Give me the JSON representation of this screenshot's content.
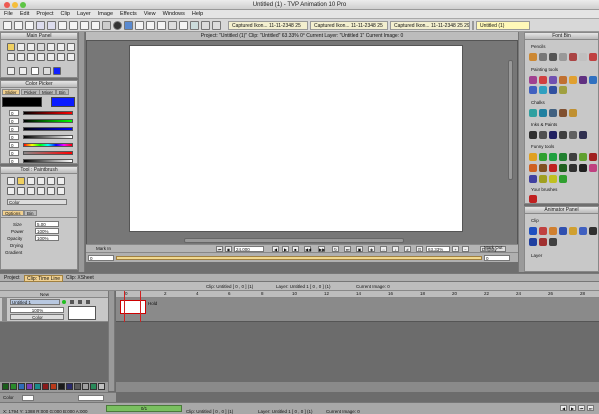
{
  "window": {
    "title": "Untitled (1) - TVP Animation 10 Pro"
  },
  "menu": [
    "File",
    "Edit",
    "Project",
    "Clip",
    "Layer",
    "Image",
    "Effects",
    "View",
    "Windows",
    "Help"
  ],
  "doc_tabs": [
    "Captured Ikon... 11-11-2348 25",
    "Captured Ikon... 11-11-2348 25",
    "Captured Ikon... 11-11-2348 25 2948",
    "Captured Ikon... 11-11-2348 25 2948",
    "Untitled (1)"
  ],
  "project_info": "Project: \"Untitled (1)\"   Clip: \"Untitled\"   63.33%   0°   Current Layer: \"Untitled 1\"   Current Image: 0",
  "main_panel": {
    "title": "Main Panel"
  },
  "color_picker": {
    "title": "Color Picker",
    "tabs": [
      "Slider",
      "Picker",
      "Mixer",
      "Bin"
    ],
    "channels": [
      "0",
      "0",
      "0",
      "0",
      "0",
      "0",
      "0"
    ]
  },
  "tool_panel": {
    "title": "Tool : Paintbrush",
    "tabs": [
      "Options",
      "Bin"
    ],
    "size_label": "Size",
    "size_value": "5.00",
    "power_label": "Power",
    "power_value": "100%",
    "opacity_label": "Opacity",
    "opacity_value": "100%",
    "drying_label": "Drying",
    "gradient_label": "Gradient",
    "mode": "Color"
  },
  "canvas_controls": {
    "mark_in": "Mark In",
    "mark_out": "Mark Out",
    "zoom": "63.33%",
    "display": "Display",
    "fps": "24.000",
    "frame_left": "0",
    "frame_right": "0"
  },
  "font_bin": {
    "title": "Font Bin",
    "sections": [
      "Pencils",
      "Painting tools",
      "Chalks",
      "Inks & Paints",
      "Funny tools",
      "Your brushes"
    ]
  },
  "animator_panel": {
    "title": "Animator Panel",
    "sections": [
      "Clip",
      "Layer"
    ]
  },
  "bottom_tabs": [
    "Project",
    "Clip: Time Line",
    "Clip: XSheet"
  ],
  "timeline_info": {
    "clip": "Clip: Untitled [ 0 , 0 ]  (1)",
    "layer": "Layer: Untitled 1 [ 0 , 0 ]  (1)",
    "image": "Current Image: 0"
  },
  "timeline": {
    "new_label": "New",
    "layer_name": "Untitled 1",
    "opacity": "100%",
    "mode": "Color",
    "hold_label": "Hold",
    "ruler": [
      "0",
      "2",
      "4",
      "6",
      "8",
      "10",
      "12",
      "14",
      "16",
      "18",
      "20",
      "22",
      "24",
      "26",
      "28"
    ]
  },
  "bottom_color": "Color",
  "status": {
    "coords": "X: 1794  Y: 1388  R:000 G:000 B:000 A:000",
    "progress": "0/1",
    "clip": "Clip: Untitled [ 0 , 0 ]  (1)",
    "layer": "Layer: Untitled 1 [ 0 , 0 ]  (1)",
    "image": "Current Image: 0"
  },
  "colors": {
    "fg": "#000000",
    "bg": "#0a1bff",
    "accent": "#f0d090",
    "bin_swatches": [
      "#1b5d1b",
      "#2a8a2a",
      "#2e6bb8",
      "#7a3ab8",
      "#1a8a8a",
      "#8a1a1a",
      "#b83a1a",
      "#1a1a1a",
      "#2a2a6a",
      "#5a5a5a",
      "#a0a0a0",
      "#2a8a5a",
      "#c0c0c0",
      "#3a9a9a",
      "#ffffff"
    ]
  }
}
